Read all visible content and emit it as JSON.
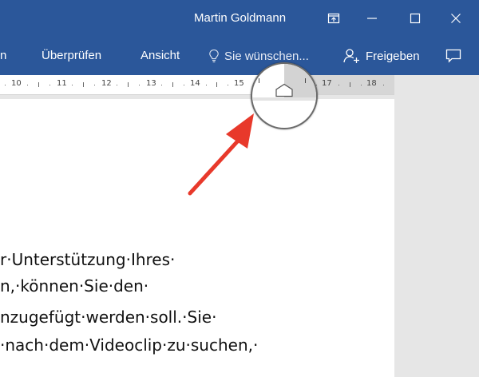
{
  "titlebar": {
    "user_name": "Martin Goldmann",
    "background": "#2b579a",
    "controls": [
      "ribbon-display-icon",
      "minimize-icon",
      "maximize-icon",
      "close-icon"
    ]
  },
  "ribbon": {
    "tabs": [
      {
        "label": "n"
      },
      {
        "label": "Überprüfen"
      },
      {
        "label": "Ansicht"
      }
    ],
    "tell_me": {
      "placeholder": "Sie wünschen...",
      "icon": "lightbulb-icon"
    },
    "share": {
      "label": "Freigeben",
      "icon": "person-add-icon"
    },
    "comment": {
      "icon": "comment-icon"
    }
  },
  "ruler": {
    "numbers": [
      "10",
      "11",
      "12",
      "13",
      "14",
      "15",
      "17",
      "18"
    ],
    "indent_marker": "hanging-indent-marker-icon"
  },
  "document": {
    "lines": [
      "r·Unterstützung·Ihres·",
      "n,·können·Sie·den·",
      "nzugefügt·werden·soll.·Sie·",
      "·nach·dem·Videoclip·zu·suchen,·"
    ]
  },
  "annotation": {
    "arrow_color": "#e8392b"
  }
}
